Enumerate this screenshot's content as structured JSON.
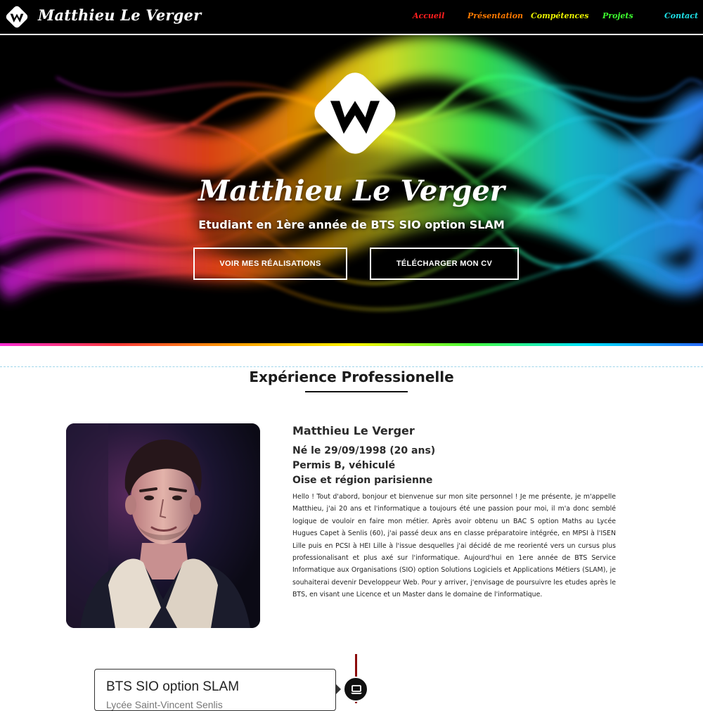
{
  "navbar": {
    "brand": "Matthieu Le Verger",
    "links": [
      {
        "label": "Accueil",
        "color": "#ff1f1f"
      },
      {
        "label": "Présentation",
        "color": "#ff7a00"
      },
      {
        "label": "Compétences",
        "color": "#e9f200"
      },
      {
        "label": "Projets",
        "color": "#3dff2e"
      },
      {
        "label": "Contact",
        "color": "#1ee0e6"
      }
    ]
  },
  "hero": {
    "name": "Matthieu Le Verger",
    "subtitle": "Etudiant en 1ère année de BTS SIO option SLAM",
    "buttons": {
      "works": "VOIR MES RÉALISATIONS",
      "cv": "TÉLÉCHARGER MON CV"
    }
  },
  "experience": {
    "title": "Expérience Professionelle",
    "name": "Matthieu Le Verger",
    "birth": "Né le 29/09/1998 (20 ans)",
    "license": "Permis B, véhiculé",
    "location": "Oise et région parisienne",
    "bio": "Hello ! Tout d'abord, bonjour et bienvenue sur mon site personnel ! Je me présente, je m'appelle Matthieu, j'ai 20 ans et l'informatique a toujours été une passion pour moi, il m'a donc semblé logique de vouloir en faire mon métier. Après avoir obtenu un BAC S option Maths au Lycée Hugues Capet à Senlis (60), j'ai passé deux ans en classe préparatoire intégrée, en MPSI à l'ISEN Lille puis en PCSI à HEI Lille à l'issue desquelles j'ai décidé de me reorienté vers un cursus plus professionalisant et plus axé sur l'informatique. Aujourd'hui en 1ere année de BTS Service Informatique aux Organisations (SIO) option Solutions Logiciels et Applications Métiers (SLAM), je souhaiterai devenir Developpeur Web. Pour y arriver, j'envisage de poursuivre les etudes après le BTS, en visant une Licence et un Master dans le domaine de l'informatique."
  },
  "timeline": {
    "card_title": "BTS SIO option SLAM",
    "card_subtitle": "Lycée Saint-Vincent Senlis"
  }
}
